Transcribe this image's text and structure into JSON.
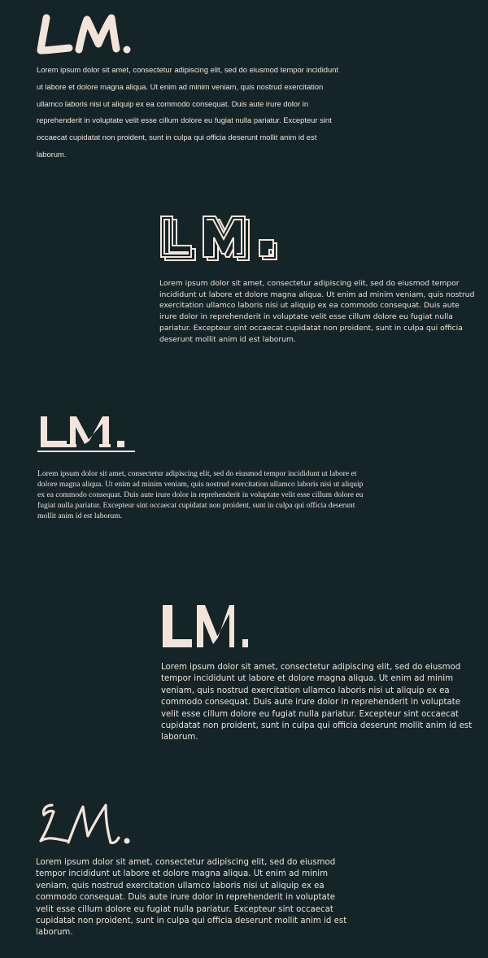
{
  "colors": {
    "background": "#152427",
    "logo": "#f3e4da",
    "text": "#eee3da"
  },
  "lorem": "Lorem ipsum dolor sit amet, consectetur adipiscing elit, sed do eiusmod tempor incididunt ut labore et dolore magna aliqua. Ut enim ad minim veniam, quis nostrud exercitation ullamco laboris nisi ut aliquip ex ea commodo consequat. Duis aute irure dolor in reprehenderit in voluptate velit esse cillum dolore eu fugiat nulla pariatur. Excepteur sint occaecat cupidatat non proident, sunt in culpa qui officia deserunt mollit anim id est laborum.",
  "logos": [
    {
      "text": "LM.",
      "style": "brush"
    },
    {
      "text": "LM.",
      "style": "outlined-3d"
    },
    {
      "text": "LM.",
      "style": "serif-underline"
    },
    {
      "text": "LM.",
      "style": "geometric"
    },
    {
      "text": "LM.",
      "style": "script"
    }
  ]
}
